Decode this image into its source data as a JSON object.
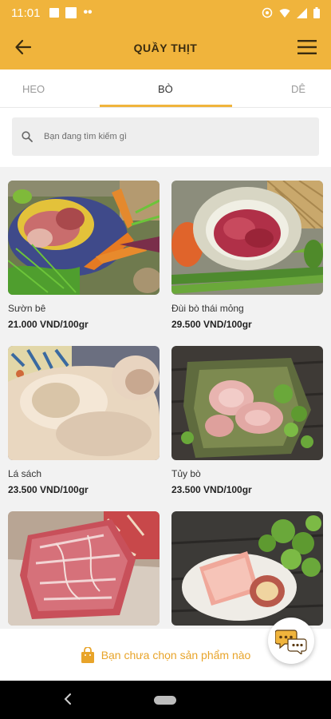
{
  "status_bar": {
    "time": "11:01"
  },
  "header": {
    "title": "QUẦY THỊT"
  },
  "tabs": [
    {
      "label": "HEO"
    },
    {
      "label": "BÒ"
    },
    {
      "label": "DÊ"
    }
  ],
  "search": {
    "placeholder": "Bạn đang tìm kiếm gì"
  },
  "products": [
    {
      "name": "Sườn bê",
      "price": "21.000 VND/100gr"
    },
    {
      "name": "Đùi bò thái mỏng",
      "price": "29.500 VND/100gr"
    },
    {
      "name": "Lá sách",
      "price": "23.500 VND/100gr"
    },
    {
      "name": "Tủy bò",
      "price": "23.500 VND/100gr"
    },
    {
      "name": "",
      "price": ""
    },
    {
      "name": "",
      "price": ""
    }
  ],
  "cart": {
    "message": "Bạn chưa chọn sản phẩm nào"
  },
  "colors": {
    "brand": "#f0b43c",
    "cart_text": "#e8a42a"
  }
}
